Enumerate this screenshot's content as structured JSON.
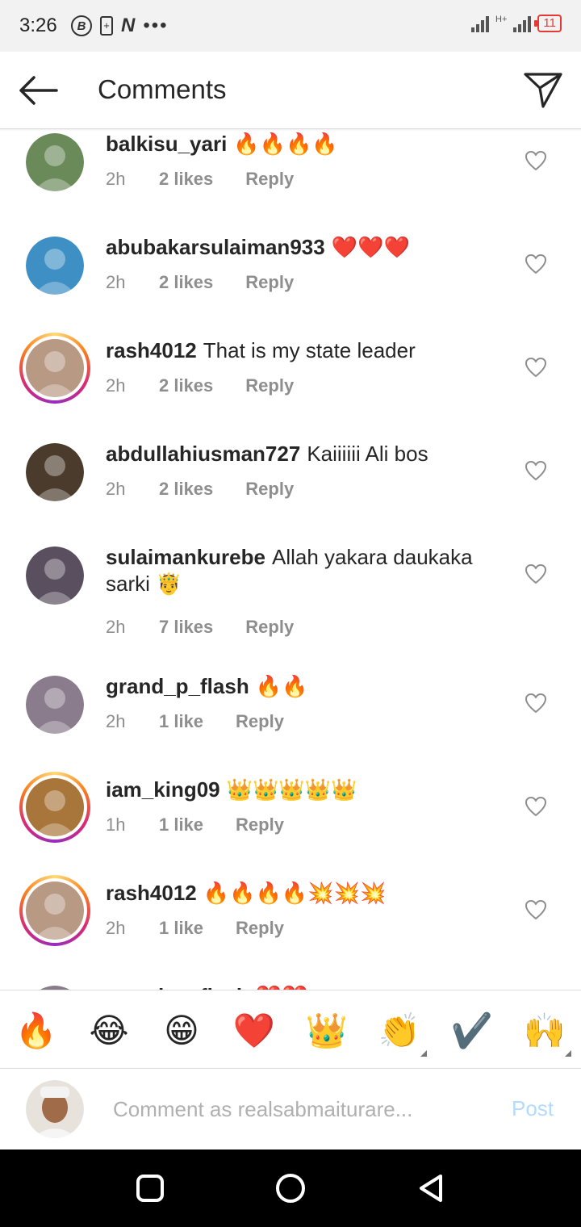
{
  "status_bar": {
    "time": "3:26",
    "b_icon_letter": "B",
    "n_icon_letter": "N",
    "dots": "•••",
    "network": "H+",
    "battery": "11"
  },
  "header": {
    "title": "Comments"
  },
  "comments": [
    {
      "username": "balkisu_yari",
      "text": "🔥🔥🔥🔥",
      "time": "2h",
      "likes": "2 likes",
      "reply": "Reply",
      "story_ring": false,
      "avatar_color": "#6a8a5a"
    },
    {
      "username": "abubakarsulaiman933",
      "text": "❤️❤️❤️",
      "time": "2h",
      "likes": "2 likes",
      "reply": "Reply",
      "story_ring": false,
      "avatar_color": "#3d8fc4"
    },
    {
      "username": "rash4012",
      "text": "That is my state leader",
      "time": "2h",
      "likes": "2 likes",
      "reply": "Reply",
      "story_ring": true,
      "avatar_color": "#b89a84"
    },
    {
      "username": "abdullahiusman727",
      "text": "Kaiiiiii Ali bos",
      "time": "2h",
      "likes": "2 likes",
      "reply": "Reply",
      "story_ring": false,
      "avatar_color": "#4a3b2c"
    },
    {
      "username": "sulaimankurebe",
      "text": "Allah yakara daukaka sarki 🤴",
      "time": "2h",
      "likes": "7 likes",
      "reply": "Reply",
      "story_ring": false,
      "avatar_color": "#5a4f5f"
    },
    {
      "username": "grand_p_flash",
      "text": "🔥🔥",
      "time": "2h",
      "likes": "1 like",
      "reply": "Reply",
      "story_ring": false,
      "avatar_color": "#8a7c8c"
    },
    {
      "username": "iam_king09",
      "text": "👑👑👑👑👑",
      "time": "1h",
      "likes": "1 like",
      "reply": "Reply",
      "story_ring": true,
      "avatar_color": "#a8763a"
    },
    {
      "username": "rash4012",
      "text": "🔥🔥🔥🔥💥💥💥",
      "time": "2h",
      "likes": "1 like",
      "reply": "Reply",
      "story_ring": true,
      "avatar_color": "#b89a84"
    },
    {
      "username": "grand_p_flash",
      "text": "❤️❤️",
      "time": "",
      "likes": "",
      "reply": "",
      "story_ring": false,
      "avatar_color": "#8a7c8c"
    }
  ],
  "emoji_bar": [
    "🔥",
    "😂",
    "😁",
    "❤️",
    "👑",
    "👏",
    "✔️",
    "🙌"
  ],
  "input": {
    "placeholder": "Comment as realsabmaiturare...",
    "post_label": "Post",
    "avatar_color": "#c9a98a"
  },
  "colors": {
    "accent_post": "#b3dbff",
    "meta_text": "#8e8e8e",
    "primary_text": "#262626"
  }
}
